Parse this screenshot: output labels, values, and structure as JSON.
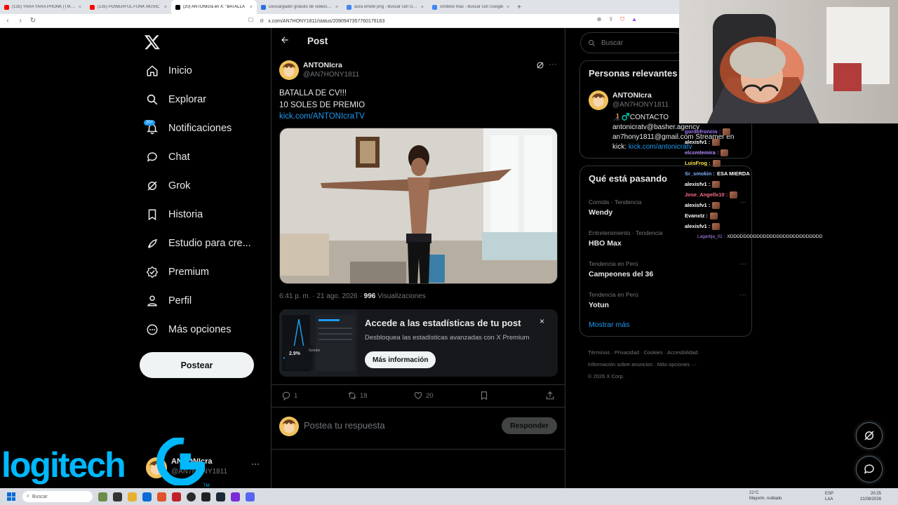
{
  "browser": {
    "tabs": [
      {
        "label": "(135) YARA YARA PHONK (TIKTOK VERSION)",
        "color": "#ff0000",
        "active": false
      },
      {
        "label": "(135) POWERFUL FUNK MUSIC",
        "color": "#ff0000",
        "active": false
      },
      {
        "label": "(20) ANTONIcra en X: \"BATALLA",
        "color": "#000000",
        "active": true
      },
      {
        "label": "Descargador gratuito de videos de",
        "color": "#2d6cdf",
        "active": false
      },
      {
        "label": "aura emote png - Buscar con Google",
        "color": "#4285f4",
        "active": false
      },
      {
        "label": "símbolo mas - Buscar con Google",
        "color": "#4285f4",
        "active": false
      }
    ],
    "new_tab": "+",
    "url": "x.com/AN7HONY1811/status/2090947357760176163"
  },
  "sidebar": {
    "items": [
      {
        "label": "Inicio",
        "icon": "home-icon"
      },
      {
        "label": "Explorar",
        "icon": "search-icon"
      },
      {
        "label": "Notificaciones",
        "icon": "bell-icon",
        "badge": "20+"
      },
      {
        "label": "Chat",
        "icon": "chat-icon"
      },
      {
        "label": "Grok",
        "icon": "grok-icon"
      },
      {
        "label": "Historia",
        "icon": "bookmark-icon"
      },
      {
        "label": "Estudio para cre...",
        "icon": "rocket-icon"
      },
      {
        "label": "Premium",
        "icon": "verified-icon"
      },
      {
        "label": "Perfil",
        "icon": "person-icon"
      },
      {
        "label": "Más opciones",
        "icon": "more-circle-icon"
      }
    ],
    "post_button": "Postear",
    "account": {
      "name": "ANTONIcra",
      "handle": "@AN7HONY1811",
      "more": "···"
    }
  },
  "main": {
    "title": "Post",
    "post": {
      "author_name": "ANTONIcra",
      "author_handle": "@AN7HONY1811",
      "text_line1": "BATALLA DE CV!!!",
      "text_line2": "10 SOLES DE PREMIO",
      "link": "kick.com/ANTONIcraTV",
      "time": "6:41 p. m. · 21 ago. 2026 · ",
      "views_count": "996",
      "views_label": " Visualizaciones"
    },
    "promo": {
      "title": "Accede a las estadísticas de tu post",
      "subtitle": "Desbloquea las estadísticas avanzadas con X Premium",
      "button": "Más información",
      "close": "×",
      "stat_value": "2.9%",
      "stat_label": "Gender"
    },
    "actions": {
      "replies": "1",
      "reposts": "18",
      "likes": "20"
    },
    "reply": {
      "placeholder": "Postea tu respuesta",
      "button": "Responder"
    }
  },
  "right": {
    "search_placeholder": "Buscar",
    "relevant": {
      "title": "Personas relevantes",
      "name": "ANTONIcra",
      "handle": "@AN7HONY1811",
      "bio_line1": "🧑‍🦯♂️CONTACTO",
      "bio_line2": "antonicratv@basher.agency",
      "bio_line3": "an7hony1811@gmail.com Streamer en",
      "bio_line4_prefix": "kick: ",
      "bio_link": "kick.com/antonicratv"
    },
    "trends": {
      "title": "Qué está pasando",
      "items": [
        {
          "meta": "Comida · Tendencia",
          "name": "Wendy"
        },
        {
          "meta": "Entretenimiento · Tendencia",
          "name": "HBO Max"
        },
        {
          "meta": "Tendencia en Perú",
          "name": "Campeones del 36"
        },
        {
          "meta": "Tendencia en Perú",
          "name": "Yotun"
        }
      ],
      "show_more": "Mostrar más"
    },
    "footer": {
      "line1": "Términos · Privacidad · Cookies · Accesibilidad ·",
      "line2": "Información sobre anuncios · Más opciones ···",
      "line3": "© 2026 X Corp."
    }
  },
  "chat": [
    {
      "user": "gordofroncio :",
      "color": "#a77bff",
      "msg": ""
    },
    {
      "user": "alexisfv1 :",
      "color": "#ffffff",
      "msg": ""
    },
    {
      "user": "elcsmtemira :",
      "color": "#b58cff",
      "msg": ""
    },
    {
      "user": "LuisFrog :",
      "color": "#ffe84a",
      "msg": ""
    },
    {
      "user": "Sr_smokin :",
      "color": "#7fb0ff",
      "msg": "ESA MIERDA"
    },
    {
      "user": "alexisfv1 :",
      "color": "#ffffff",
      "msg": ""
    },
    {
      "user": "Jose_Angellx10 :",
      "color": "#ff6f8a",
      "msg": ""
    },
    {
      "user": "alexisfv1 :",
      "color": "#ffffff",
      "msg": ""
    },
    {
      "user": "Evanxtz :",
      "color": "#ffffff",
      "msg": ""
    },
    {
      "user": "alexisfv1 :",
      "color": "#ffffff",
      "msg": ""
    },
    {
      "user": "Lagartija_01 :",
      "color": "#b58cff",
      "msg": "XDDDDDDDDDDDDDDDDDDDDDDDDDDDD"
    }
  ],
  "overlay": {
    "brand": "logitech",
    "tm": "TM"
  },
  "taskbar": {
    "search": "Buscar",
    "weather_temp": "21°C",
    "weather_desc": "Mayorm. nublado",
    "lang": "ESP",
    "lang2": "LAA",
    "time": "20:25",
    "date": "21/08/2026"
  },
  "colors": {
    "accent": "#1d9bf0",
    "background": "#000000",
    "border": "#2f3336",
    "muted": "#71767b"
  }
}
